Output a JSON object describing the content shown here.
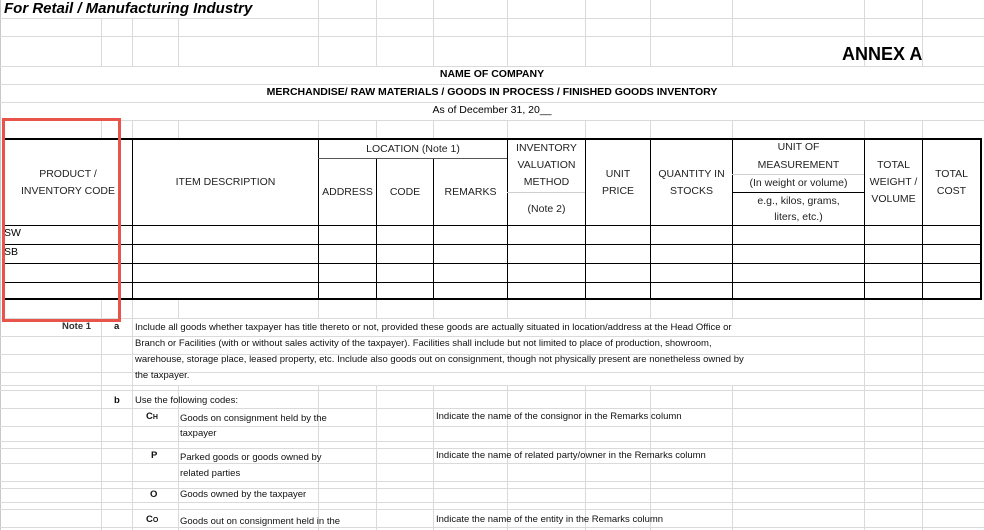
{
  "document": {
    "title": "For Retail / Manufacturing Industry",
    "annex": "ANNEX A",
    "company_name": "NAME OF COMPANY",
    "inventory_heading": "MERCHANDISE/ RAW MATERIALS / GOODS IN PROCESS / FINISHED GOODS INVENTORY",
    "as_of": "As of December 31, 20__"
  },
  "table": {
    "headers": {
      "product_code_line1": "PRODUCT /",
      "product_code_line2": "INVENTORY CODE",
      "item_description": "ITEM DESCRIPTION",
      "location": "LOCATION (Note 1)",
      "address": "ADDRESS",
      "code": "CODE",
      "remarks": "REMARKS",
      "valuation_line1": "INVENTORY",
      "valuation_line2": "VALUATION",
      "valuation_line3": "METHOD",
      "valuation_note": "(Note 2)",
      "unit_price_line1": "UNIT",
      "unit_price_line2": "PRICE",
      "quantity_line1": "QUANTITY IN",
      "quantity_line2": "STOCKS",
      "uom_line1": "UNIT OF",
      "uom_line2": "MEASUREMENT",
      "uom_line3": "(In weight or volume)",
      "uom_line4": "e.g., kilos, grams,",
      "uom_line5": "liters, etc.)",
      "weight_line1": "TOTAL",
      "weight_line2": "WEIGHT /",
      "weight_line3": "VOLUME",
      "cost_line1": "TOTAL",
      "cost_line2": "COST"
    },
    "rows": [
      {
        "code": "SW"
      },
      {
        "code": "SB"
      },
      {
        "code": ""
      },
      {
        "code": ""
      }
    ]
  },
  "notes": {
    "note1_label": "Note 1",
    "a_label": "a",
    "a_text": [
      "Include all goods whether taxpayer has title thereto or not, provided these goods are actually situated in location/address at the Head Office or",
      "Branch or Facilities (with or without sales activity of the taxpayer).  Facilities shall include but not limited to place of production, showroom,",
      "warehouse, storage place, leased property, etc.  Include also goods out on consignment, though not physically present are nonetheless owned by",
      "the taxpayer."
    ],
    "b_label": "b",
    "b_text": "Use the following codes:",
    "codes": [
      {
        "code": "C",
        "sub": "H",
        "desc1": "Goods on consignment held by the",
        "desc2": "taxpayer",
        "instruction": "Indicate the name of the consignor in the Remarks column"
      },
      {
        "code": "P",
        "sub": "",
        "desc1": "Parked goods or goods owned by",
        "desc2": "related parties",
        "instruction": "Indicate the name of related party/owner in the Remarks column"
      },
      {
        "code": "O",
        "sub": "",
        "desc1": "Goods owned by the taxpayer",
        "desc2": "",
        "instruction": ""
      },
      {
        "code": "C",
        "sub": "O",
        "desc1": "Goods out on consignment held in the",
        "desc2": "",
        "instruction": "Indicate the name of the entity in the Remarks column"
      }
    ]
  },
  "highlight": {
    "color": "#e8534a"
  }
}
